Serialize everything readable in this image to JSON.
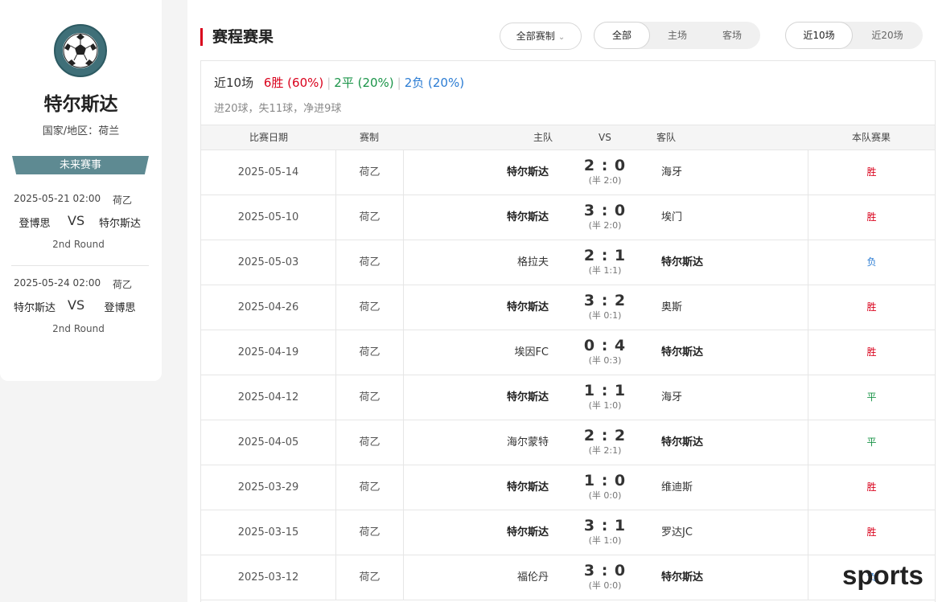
{
  "team": {
    "name": "特尔斯达",
    "region_label": "国家/地区：",
    "region": "荷兰",
    "logo_icon": "soccer-ball-crest"
  },
  "future": {
    "title": "未来赛事",
    "matches": [
      {
        "datetime": "2025-05-21 02:00",
        "league": "荷乙",
        "home": "登博思",
        "vs": "VS",
        "away": "特尔斯达",
        "round": "2nd Round"
      },
      {
        "datetime": "2025-05-24 02:00",
        "league": "荷乙",
        "home": "特尔斯达",
        "vs": "VS",
        "away": "登博思",
        "round": "2nd Round"
      }
    ]
  },
  "main": {
    "title": "赛程赛果",
    "competition_filter": "全部赛制",
    "venue_tabs": [
      "全部",
      "主场",
      "客场"
    ],
    "venue_active": 0,
    "range_tabs": [
      "近10场",
      "近20场"
    ],
    "range_active": 0,
    "summary": {
      "label": "近10场",
      "wins": "6胜 (60%)",
      "draws": "2平 (20%)",
      "losses": "2负 (20%)",
      "goals": "进20球，失11球，净进9球"
    },
    "columns": [
      "比赛日期",
      "赛制",
      "主队",
      "VS",
      "客队",
      "本队赛果"
    ],
    "rows": [
      {
        "date": "2025-05-14",
        "league": "荷乙",
        "home": "特尔斯达",
        "score": "2 : 0",
        "half": "(半 2:0)",
        "away": "海牙",
        "result": "胜",
        "type": "win",
        "team_side": "home"
      },
      {
        "date": "2025-05-10",
        "league": "荷乙",
        "home": "特尔斯达",
        "score": "3 : 0",
        "half": "(半 2:0)",
        "away": "埃门",
        "result": "胜",
        "type": "win",
        "team_side": "home"
      },
      {
        "date": "2025-05-03",
        "league": "荷乙",
        "home": "格拉夫",
        "score": "2 : 1",
        "half": "(半 1:1)",
        "away": "特尔斯达",
        "result": "负",
        "type": "loss",
        "team_side": "away"
      },
      {
        "date": "2025-04-26",
        "league": "荷乙",
        "home": "特尔斯达",
        "score": "3 : 2",
        "half": "(半 0:1)",
        "away": "奥斯",
        "result": "胜",
        "type": "win",
        "team_side": "home"
      },
      {
        "date": "2025-04-19",
        "league": "荷乙",
        "home": "埃因FC",
        "score": "0 : 4",
        "half": "(半 0:3)",
        "away": "特尔斯达",
        "result": "胜",
        "type": "win",
        "team_side": "away"
      },
      {
        "date": "2025-04-12",
        "league": "荷乙",
        "home": "特尔斯达",
        "score": "1 : 1",
        "half": "(半 1:0)",
        "away": "海牙",
        "result": "平",
        "type": "draw",
        "team_side": "home"
      },
      {
        "date": "2025-04-05",
        "league": "荷乙",
        "home": "海尔蒙特",
        "score": "2 : 2",
        "half": "(半 2:1)",
        "away": "特尔斯达",
        "result": "平",
        "type": "draw",
        "team_side": "away"
      },
      {
        "date": "2025-03-29",
        "league": "荷乙",
        "home": "特尔斯达",
        "score": "1 : 0",
        "half": "(半 0:0)",
        "away": "维迪斯",
        "result": "胜",
        "type": "win",
        "team_side": "home"
      },
      {
        "date": "2025-03-15",
        "league": "荷乙",
        "home": "特尔斯达",
        "score": "3 : 1",
        "half": "(半 1:0)",
        "away": "罗达JC",
        "result": "胜",
        "type": "win",
        "team_side": "home"
      },
      {
        "date": "2025-03-12",
        "league": "荷乙",
        "home": "福伦丹",
        "score": "3 : 0",
        "half": "(半 0:0)",
        "away": "特尔斯达",
        "result": "负",
        "type": "loss",
        "team_side": "away"
      }
    ]
  },
  "colors": {
    "win": "#d9001b",
    "draw": "#1a9448",
    "loss": "#2b7cd3",
    "accent": "#d9001b",
    "banner": "#5e8a92"
  },
  "watermark": "sports"
}
